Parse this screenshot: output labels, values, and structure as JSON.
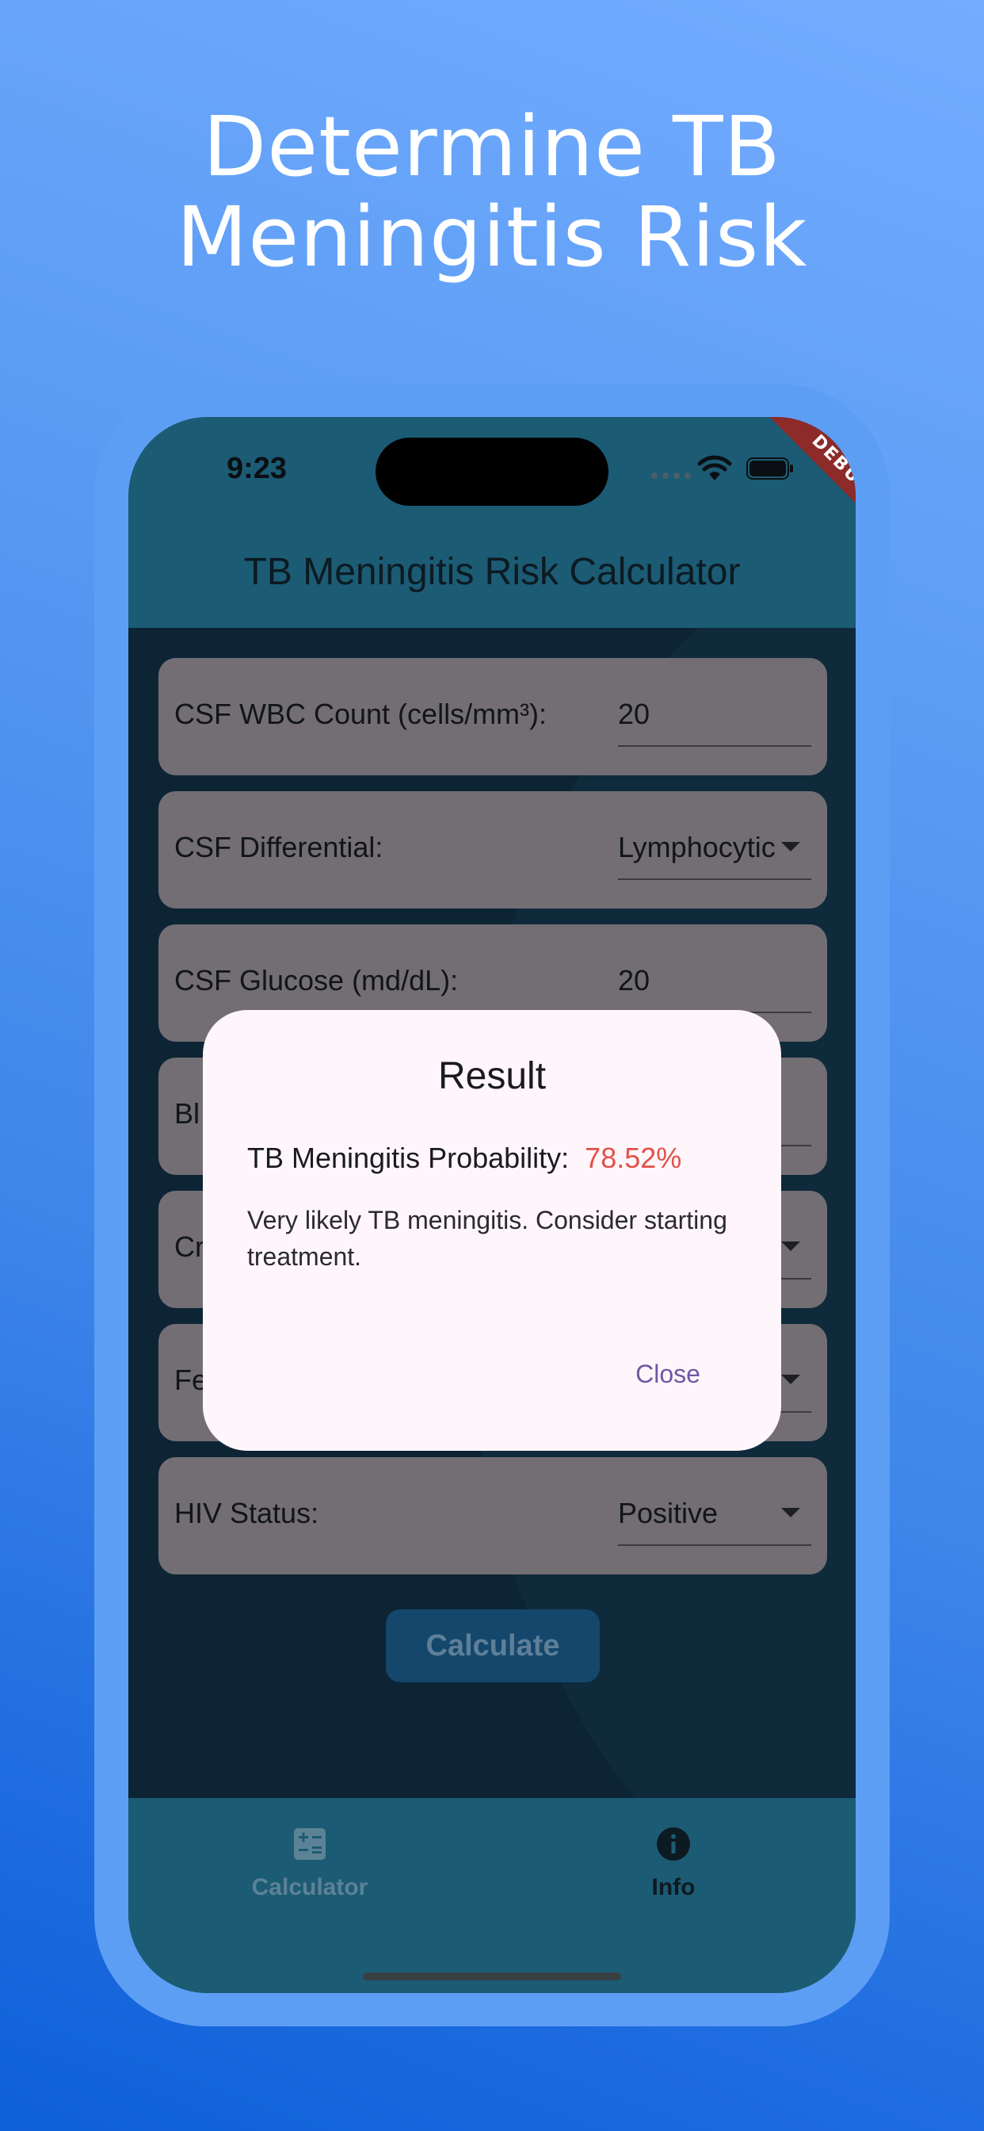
{
  "headline": {
    "line1": "Determine TB",
    "line2": "Meningitis Risk"
  },
  "status_bar": {
    "time": "9:23",
    "debug_label": "DEBUG",
    "icons": [
      "wifi-icon",
      "battery-icon"
    ]
  },
  "app_bar": {
    "title": "TB Meningitis Risk Calculator"
  },
  "fields": [
    {
      "label": "CSF WBC Count (cells/mm³):",
      "value": "20",
      "type": "text"
    },
    {
      "label": "CSF Differential:",
      "value": "Lymphocytic",
      "type": "dropdown"
    },
    {
      "label": "CSF Glucose (md/dL):",
      "value": "20",
      "type": "text"
    },
    {
      "label": "Bl",
      "value": "",
      "type": "text"
    },
    {
      "label": "Cr",
      "value": "",
      "type": "dropdown"
    },
    {
      "label": "Fe",
      "value": "",
      "type": "dropdown"
    },
    {
      "label": "HIV Status:",
      "value": "Positive",
      "type": "dropdown"
    }
  ],
  "calculate_button": "Calculate",
  "bottom_nav": {
    "items": [
      {
        "label": "Calculator",
        "icon": "calculator-icon"
      },
      {
        "label": "Info",
        "icon": "info-icon"
      }
    ]
  },
  "dialog": {
    "title": "Result",
    "probability_label": "TB Meningitis Probability:",
    "probability_value": "78.52%",
    "message": "Very likely TB meningitis. Consider starting treatment.",
    "close_label": "Close"
  },
  "colors": {
    "accent_result": "#e2524a",
    "close_text": "#6b5aa6",
    "app_bar": "#1c5b74"
  }
}
